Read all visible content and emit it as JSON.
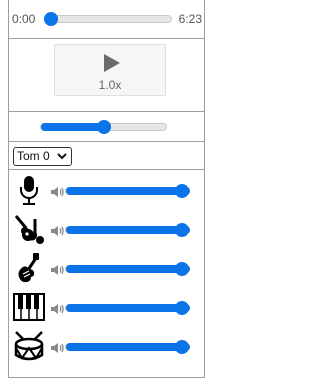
{
  "player": {
    "current_time": "0:00",
    "duration": "6:23",
    "progress_fraction": 0.0,
    "speed_label": "1.0x",
    "master_volume_fraction": 0.5
  },
  "track_select": {
    "selected": "Tom 0"
  },
  "instruments": [
    {
      "name": "microphone-icon",
      "volume_fraction": 1.0
    },
    {
      "name": "saxophone-guitar-icon",
      "volume_fraction": 1.0
    },
    {
      "name": "bass-guitar-icon",
      "volume_fraction": 1.0
    },
    {
      "name": "piano-keys-icon",
      "volume_fraction": 1.0
    },
    {
      "name": "drum-icon",
      "volume_fraction": 1.0
    }
  ],
  "colors": {
    "accent": "#0a74e8",
    "track": "#e5e5e5",
    "border": "#9e9e9e"
  }
}
